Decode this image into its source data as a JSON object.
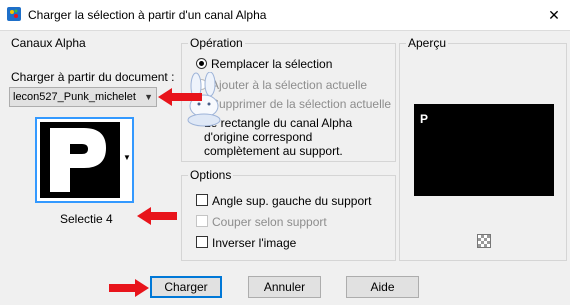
{
  "window": {
    "title": "Charger la sélection à partir d'un canal Alpha",
    "close_glyph": "✕"
  },
  "channels": {
    "group_label": "Canaux Alpha",
    "source_label": "Charger à partir du document :",
    "document_value": "lecon527_Punk_michelet",
    "channel_thumb_letter": "P",
    "channel_name": "Selectie 4"
  },
  "operation": {
    "group_label": "Opération",
    "options": [
      {
        "label": "Remplacer la sélection",
        "selected": true,
        "enabled": true
      },
      {
        "label": "Ajouter à la sélection actuelle",
        "selected": false,
        "enabled": false
      },
      {
        "label": "Supprimer de la sélection actuelle",
        "selected": false,
        "enabled": false
      }
    ],
    "note_lines": [
      "Le rectangle du canal Alpha",
      "d'origine correspond",
      "complètement au support."
    ]
  },
  "options": {
    "group_label": "Options",
    "checkboxes": [
      {
        "label": "Angle sup. gauche du support",
        "checked": false,
        "enabled": true
      },
      {
        "label": "Couper selon support",
        "checked": false,
        "enabled": false
      },
      {
        "label": "Inverser l'image",
        "checked": false,
        "enabled": true
      }
    ]
  },
  "preview": {
    "group_label": "Aperçu",
    "letter": "P"
  },
  "buttons": {
    "load": "Charger",
    "cancel": "Annuler",
    "help": "Aide"
  },
  "colors": {
    "accent": "#0078d7",
    "annotation_arrow": "#e8141b"
  }
}
